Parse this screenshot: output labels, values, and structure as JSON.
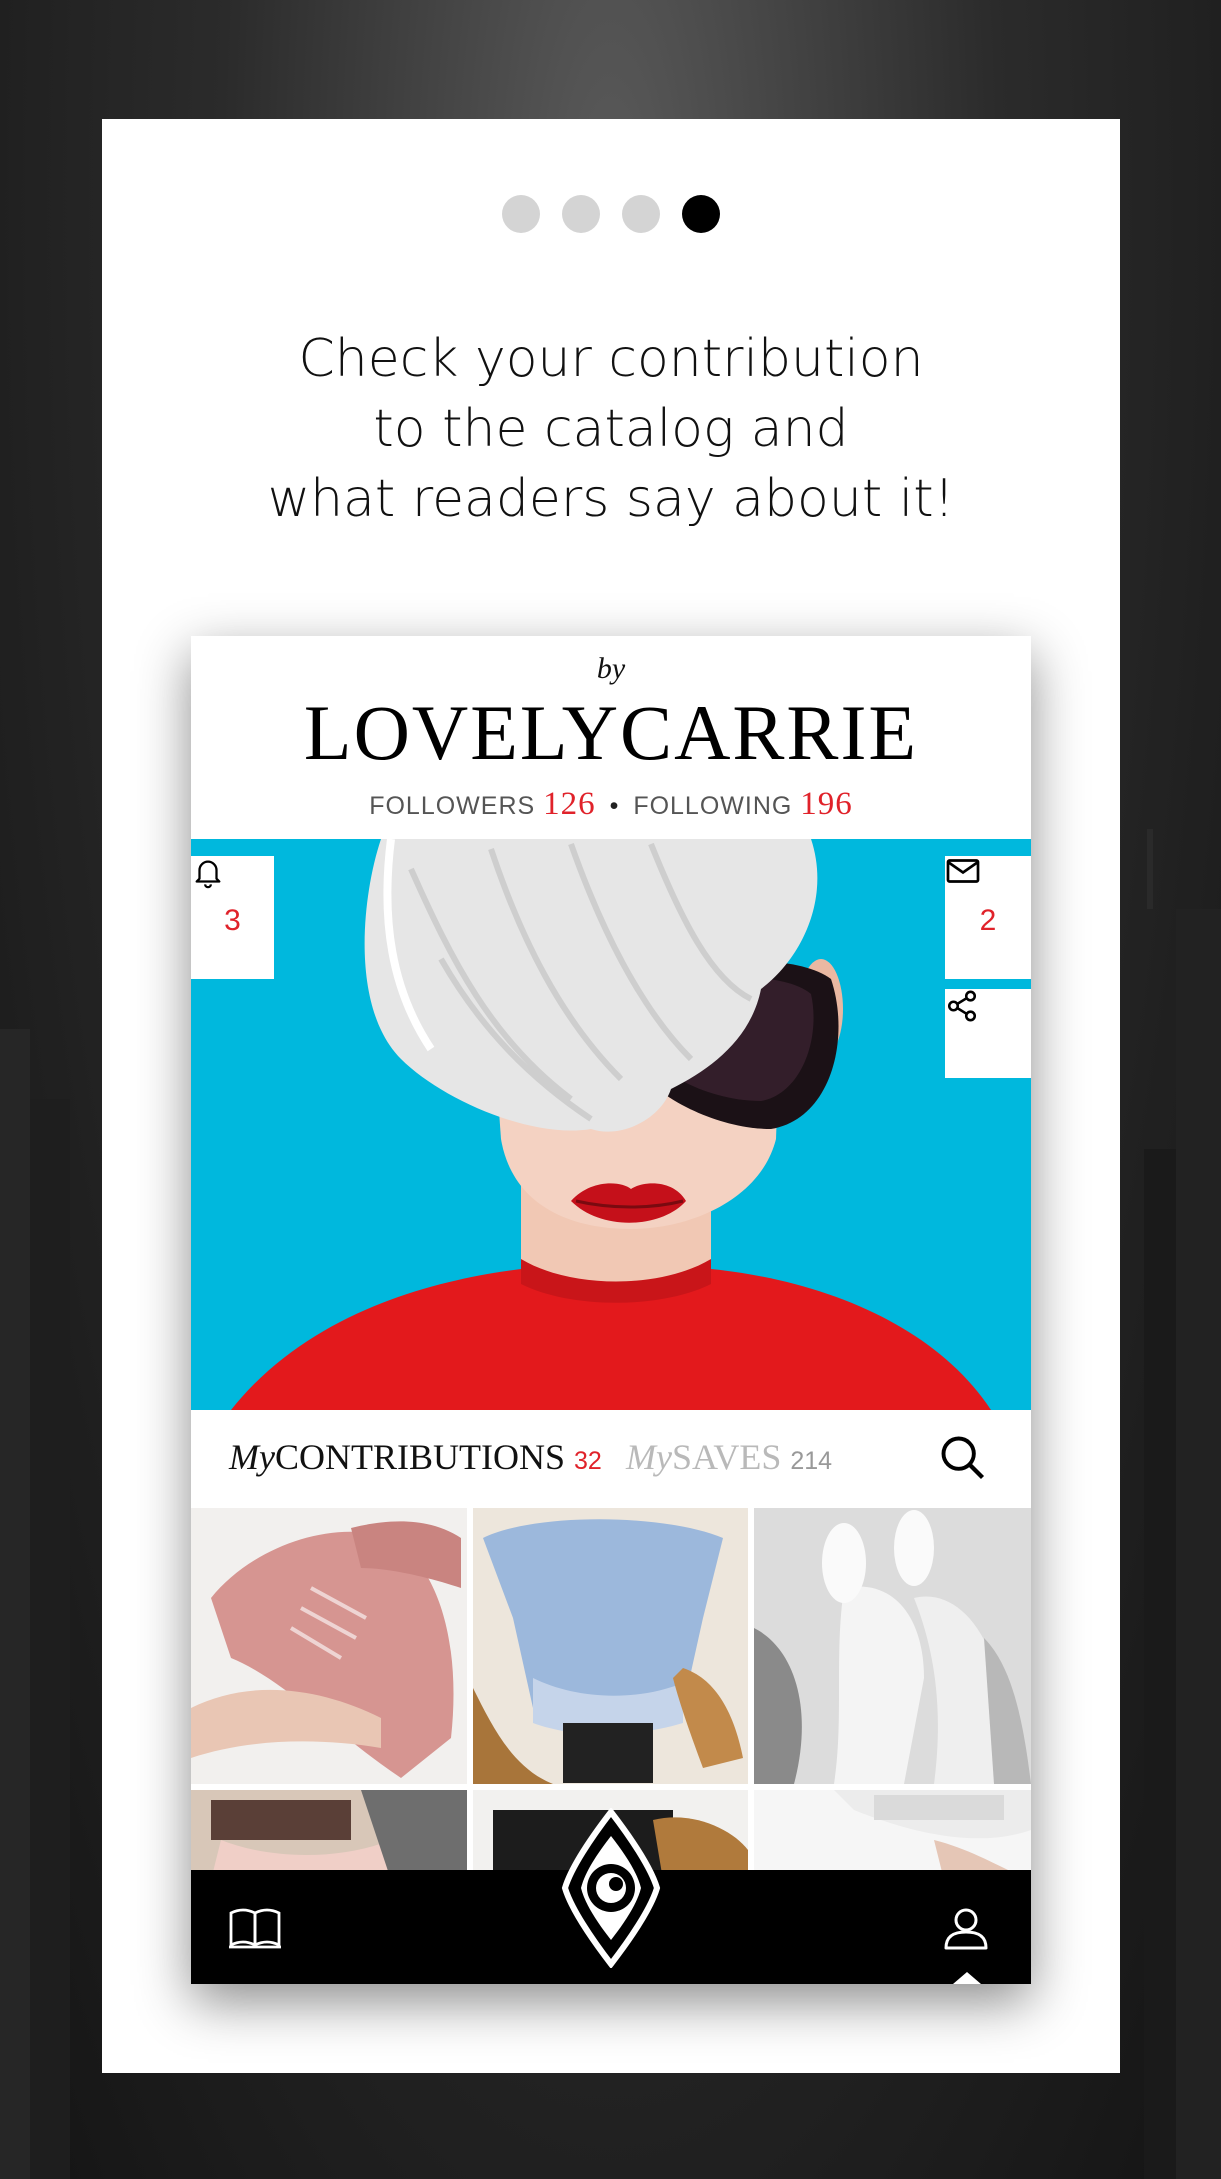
{
  "pager": {
    "total": 4,
    "active_index": 3
  },
  "headline": {
    "line1": "Check your contribution",
    "line2": "to the catalog and",
    "line3": "what readers say about it!"
  },
  "profile": {
    "by": "by",
    "name": "LOVELYCARRIE",
    "followers_label": "FOLLOWERS",
    "followers_count": "126",
    "separator": "•",
    "following_label": "FOLLOWING",
    "following_count": "196"
  },
  "hero": {
    "notifications_icon": "bell-icon",
    "notifications_count": "3",
    "messages_icon": "mail-icon",
    "messages_count": "2",
    "share_icon": "share-icon"
  },
  "tabs": {
    "contributions_prefix": "My",
    "contributions_label": "CONTRIBUTIONS",
    "contributions_count": "32",
    "saves_prefix": "My",
    "saves_label": "SAVES",
    "saves_count": "214",
    "search_icon": "search-icon"
  },
  "navbar": {
    "left_icon": "book-icon",
    "center_icon": "eye-logo-icon",
    "right_icon": "user-icon"
  },
  "colors": {
    "accent": "#e0222a",
    "hero_background": "#00b8dd",
    "navbar": "#000000"
  }
}
